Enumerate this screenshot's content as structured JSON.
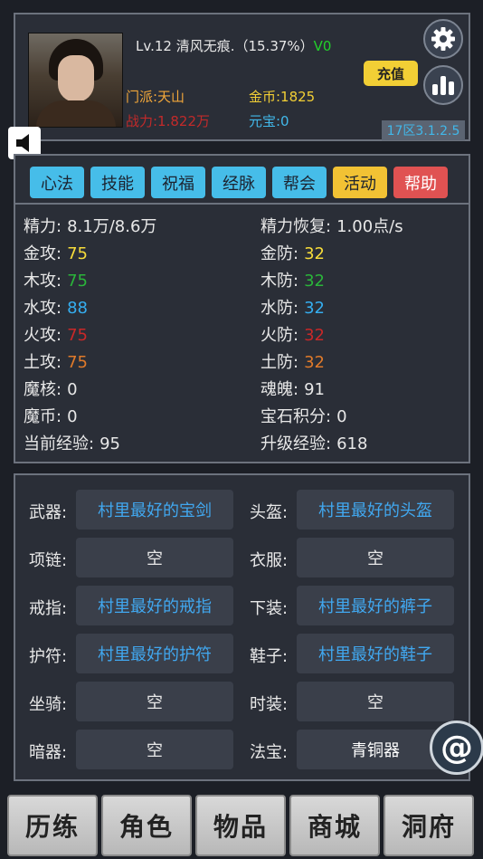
{
  "header": {
    "level_line": "Lv.12 清风无痕.（15.37%）",
    "vip": "V0",
    "sect": "门派:天山",
    "power": "战力:1.822万",
    "gold": "金币:1825",
    "yuanbao": "元宝:0",
    "recharge_label": "充值",
    "server": "17区3.1.2.5",
    "colors": {
      "sect": "#f2a73a",
      "power": "#c22a2a",
      "gold": "#f2cf35",
      "yuanbao": "#41b8ea",
      "vip": "#22d02a"
    }
  },
  "tabs": [
    {
      "label": "心法",
      "color": "#46bde9"
    },
    {
      "label": "技能",
      "color": "#46bde9"
    },
    {
      "label": "祝福",
      "color": "#46bde9"
    },
    {
      "label": "经脉",
      "color": "#46bde9"
    },
    {
      "label": "帮会",
      "color": "#46bde9"
    },
    {
      "label": "活动",
      "color": "#f2c234"
    },
    {
      "label": "帮助",
      "color": "#e05252"
    }
  ],
  "stats": {
    "left": [
      {
        "label": "精力:",
        "value": "8.1万/8.6万",
        "color": "#e8e8e8"
      },
      {
        "label": "金攻:",
        "value": "75",
        "color": "#f7dc3a"
      },
      {
        "label": "木攻:",
        "value": "75",
        "color": "#2ab53a"
      },
      {
        "label": "水攻:",
        "value": "88",
        "color": "#35aef0"
      },
      {
        "label": "火攻:",
        "value": "75",
        "color": "#c92828"
      },
      {
        "label": "土攻:",
        "value": "75",
        "color": "#e07a2a"
      },
      {
        "label": "魔核:",
        "value": "0",
        "color": "#e8e8e8"
      },
      {
        "label": "魔币:",
        "value": "0",
        "color": "#e8e8e8"
      },
      {
        "label": "当前经验:",
        "value": "95",
        "color": "#e8e8e8"
      }
    ],
    "right": [
      {
        "label": "精力恢复:",
        "value": "1.00点/s",
        "color": "#e8e8e8"
      },
      {
        "label": "金防:",
        "value": "32",
        "color": "#f7dc3a"
      },
      {
        "label": "木防:",
        "value": "32",
        "color": "#2ab53a"
      },
      {
        "label": "水防:",
        "value": "32",
        "color": "#35aef0"
      },
      {
        "label": "火防:",
        "value": "32",
        "color": "#c92828"
      },
      {
        "label": "土防:",
        "value": "32",
        "color": "#e07a2a"
      },
      {
        "label": "魂魄:",
        "value": "91",
        "color": "#e8e8e8"
      },
      {
        "label": "宝石积分:",
        "value": "0",
        "color": "#e8e8e8"
      },
      {
        "label": "升级经验:",
        "value": "618",
        "color": "#e8e8e8"
      }
    ]
  },
  "equipment": [
    {
      "label": "武器:",
      "item": "村里最好的宝剑",
      "color": "#41a8f0"
    },
    {
      "label": "头盔:",
      "item": "村里最好的头盔",
      "color": "#41a8f0"
    },
    {
      "label": "项链:",
      "item": "空",
      "color": "#e8e8e8"
    },
    {
      "label": "衣服:",
      "item": "空",
      "color": "#e8e8e8"
    },
    {
      "label": "戒指:",
      "item": "村里最好的戒指",
      "color": "#41a8f0"
    },
    {
      "label": "下装:",
      "item": "村里最好的裤子",
      "color": "#41a8f0"
    },
    {
      "label": "护符:",
      "item": "村里最好的护符",
      "color": "#41a8f0"
    },
    {
      "label": "鞋子:",
      "item": "村里最好的鞋子",
      "color": "#41a8f0"
    },
    {
      "label": "坐骑:",
      "item": "空",
      "color": "#e8e8e8"
    },
    {
      "label": "时装:",
      "item": "空",
      "color": "#e8e8e8"
    },
    {
      "label": "暗器:",
      "item": "空",
      "color": "#e8e8e8"
    },
    {
      "label": "法宝:",
      "item": "青铜器",
      "color": "#ffffff"
    }
  ],
  "chat_icon": "@",
  "bottom_nav": [
    "历练",
    "角色",
    "物品",
    "商城",
    "洞府"
  ]
}
